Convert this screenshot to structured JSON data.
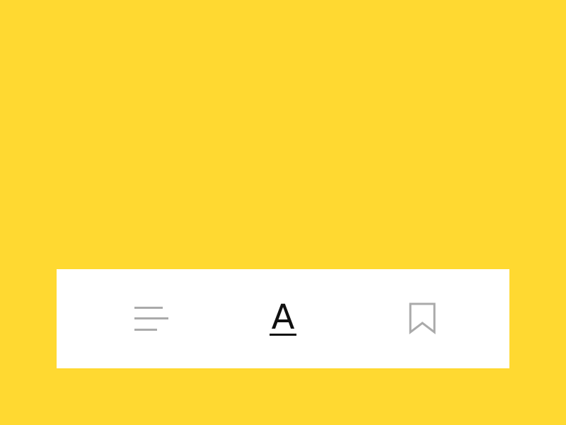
{
  "colors": {
    "background": "#FFD931",
    "toolbar": "#FFFFFF",
    "inactive_icon": "#AAAAAA",
    "active_icon": "#111111"
  },
  "toolbar": {
    "items": [
      {
        "icon": "menu-lines-icon",
        "active": false
      },
      {
        "icon": "font-icon",
        "label": "A",
        "active": true
      },
      {
        "icon": "bookmark-icon",
        "active": false
      }
    ]
  }
}
